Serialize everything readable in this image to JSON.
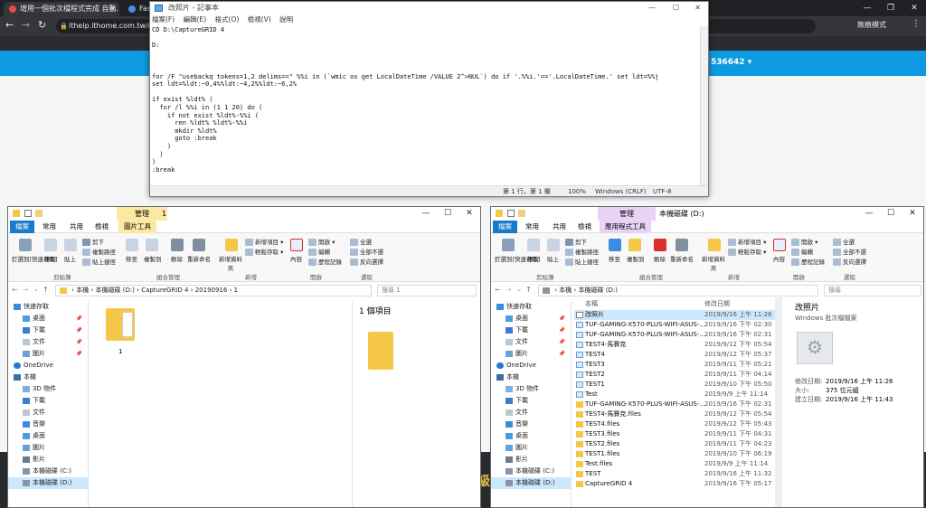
{
  "browser": {
    "tabs": [
      {
        "title": "增用一個批次檔程式完成 自動…"
      },
      {
        "title": "Fas"
      }
    ],
    "url": "ithelp.ithome.com.tw/qu",
    "incognito": "無痕模式",
    "page_fragment": "536642 ▾",
    "side_char": "級"
  },
  "notepad": {
    "title": "改照片 - 記事本",
    "menu": [
      "檔案(F)",
      "編輯(E)",
      "格式(O)",
      "檢視(V)",
      "說明"
    ],
    "content": "CD D:\\CaptureGRID 4\n\nD:\n\n\n\nfor /F \"usebackq tokens=1,2 delims==\" %%i in (`wmic os get LocalDateTime /VALUE 2^>NUL`) do if '.%%i.'=='.LocalDateTime.' set ldt=%%j\nset ldt=%ldt:~0,4%%ldt:~4,2%%ldt:~6,2%\n\nif exist %ldt% (\n  for /l %%i in (1 1 20) do (\n    if not exist %ldt%-%%i (\n      ren %ldt% %ldt%-%%i\n      mkdir %ldt%\n      goto :break\n    )\n  )\n)\n:break",
    "status": {
      "position": "第 1 行，第 1 欄",
      "zoom": "100%",
      "eol": "Windows (CRLF)",
      "encoding": "UTF-8"
    }
  },
  "left_explorer": {
    "title": "1",
    "context_tab": "管理",
    "tabs": [
      "檔案",
      "常用",
      "共用",
      "檢視",
      "圖片工具"
    ],
    "ribbon": {
      "pin": "釘選到[快速存取]",
      "copy": "複製",
      "paste": "貼上",
      "cut": "剪下",
      "copy_path": "複製路徑",
      "paste_shortcut": "貼上捷徑",
      "move_to": "移至",
      "copy_to": "複製到",
      "delete": "刪除",
      "rename": "重新命名",
      "new_folder": "新增資料夾",
      "new_item": "新增項目 ▾",
      "easy_access": "輕鬆存取 ▾",
      "properties": "內容",
      "open": "開啟 ▾",
      "edit": "編輯",
      "history": "歷程記錄",
      "select_all": "全選",
      "select_none": "全部不選",
      "invert": "反向選擇",
      "groups": [
        "剪貼簿",
        "組合管理",
        "新增",
        "開啟",
        "選取"
      ]
    },
    "breadcrumb": [
      "本機",
      "本機磁碟 (D:)",
      "CaptureGRID 4",
      "20190916",
      "1"
    ],
    "search_placeholder": "搜尋 1",
    "nav": [
      {
        "label": "快速存取",
        "pin": false
      },
      {
        "label": "桌面",
        "pin": true
      },
      {
        "label": "下載",
        "pin": true
      },
      {
        "label": "文件",
        "pin": true
      },
      {
        "label": "圖片",
        "pin": true
      },
      {
        "label": "OneDrive",
        "pin": false
      },
      {
        "label": "本機",
        "pin": false
      },
      {
        "label": "3D 物件",
        "pin": false
      },
      {
        "label": "下載",
        "pin": false
      },
      {
        "label": "文件",
        "pin": false
      },
      {
        "label": "音樂",
        "pin": false
      },
      {
        "label": "桌面",
        "pin": false
      },
      {
        "label": "圖片",
        "pin": false
      },
      {
        "label": "影片",
        "pin": false
      },
      {
        "label": "本機磁碟 (C:)",
        "pin": false
      },
      {
        "label": "本機磁碟 (D:)",
        "pin": false
      }
    ],
    "folder_item": "1",
    "preview_count": "1 個項目"
  },
  "right_explorer": {
    "title": "本機磁碟 (D:)",
    "context_tab": "管理",
    "tabs": [
      "檔案",
      "常用",
      "共用",
      "檢視",
      "應用程式工具"
    ],
    "breadcrumb": [
      "本機",
      "本機磁碟 (D:)"
    ],
    "search_placeholder": "搜尋",
    "columns": {
      "name": "名稱",
      "date": "修改日期"
    },
    "files": [
      {
        "name": "改照片",
        "date": "2019/9/16 上午 11:26",
        "kind": "doc"
      },
      {
        "name": "TUF-GAMING-X570-PLUS-WIFI-ASUS-...",
        "date": "2019/9/16 下午 02:30",
        "kind": "htm"
      },
      {
        "name": "TUF-GAMING-X570-PLUS-WIFI-ASUS-...",
        "date": "2019/9/16 下午 02:31",
        "kind": "htm"
      },
      {
        "name": "TEST4-馬賽克",
        "date": "2019/9/12 下午 05:54",
        "kind": "htm"
      },
      {
        "name": "TEST4",
        "date": "2019/9/12 下午 05:37",
        "kind": "htm"
      },
      {
        "name": "TEST3",
        "date": "2019/9/11 下午 05:21",
        "kind": "htm"
      },
      {
        "name": "TEST2",
        "date": "2019/9/11 下午 04:14",
        "kind": "htm"
      },
      {
        "name": "TEST1",
        "date": "2019/9/10 下午 05:50",
        "kind": "htm"
      },
      {
        "name": "Test",
        "date": "2019/9/9 上午 11:14",
        "kind": "htm"
      },
      {
        "name": "TUF-GAMING-X570-PLUS-WIFI-ASUS-...",
        "date": "2019/9/16 下午 02:31",
        "kind": "folder"
      },
      {
        "name": "TEST4-馬賽克.files",
        "date": "2019/9/12 下午 05:54",
        "kind": "folder"
      },
      {
        "name": "TEST4.files",
        "date": "2019/9/12 下午 05:43",
        "kind": "folder"
      },
      {
        "name": "TEST3.files",
        "date": "2019/9/11 下午 04:31",
        "kind": "folder"
      },
      {
        "name": "TEST2.files",
        "date": "2019/9/11 下午 04:23",
        "kind": "folder"
      },
      {
        "name": "TEST1.files",
        "date": "2019/9/10 下午 06:19",
        "kind": "folder"
      },
      {
        "name": "Test.files",
        "date": "2019/9/9 上午 11:14",
        "kind": "folder"
      },
      {
        "name": "TEST",
        "date": "2019/9/16 上午 11:32",
        "kind": "folder"
      },
      {
        "name": "CaptureGRID 4",
        "date": "2019/9/16 下午 05:17",
        "kind": "folder"
      }
    ],
    "nav": [
      {
        "label": "快速存取",
        "pin": false
      },
      {
        "label": "桌面",
        "pin": true
      },
      {
        "label": "下載",
        "pin": true
      },
      {
        "label": "文件",
        "pin": true
      },
      {
        "label": "圖片",
        "pin": true
      },
      {
        "label": "OneDrive",
        "pin": false
      },
      {
        "label": "本機",
        "pin": false
      },
      {
        "label": "3D 物件",
        "pin": false
      },
      {
        "label": "下載",
        "pin": false
      },
      {
        "label": "文件",
        "pin": false
      },
      {
        "label": "音樂",
        "pin": false
      },
      {
        "label": "桌面",
        "pin": false
      },
      {
        "label": "圖片",
        "pin": false
      },
      {
        "label": "影片",
        "pin": false
      },
      {
        "label": "本機磁碟 (C:)",
        "pin": false
      },
      {
        "label": "本機磁碟 (D:)",
        "pin": false
      }
    ],
    "details": {
      "name": "改照片",
      "type": "Windows 批次檔檔案",
      "modified_label": "修改日期:",
      "modified": "2019/9/16 上午 11:26",
      "size_label": "大小:",
      "size": "375 位元組",
      "created_label": "建立日期:",
      "created": "2019/9/16 上午 11:43"
    }
  }
}
